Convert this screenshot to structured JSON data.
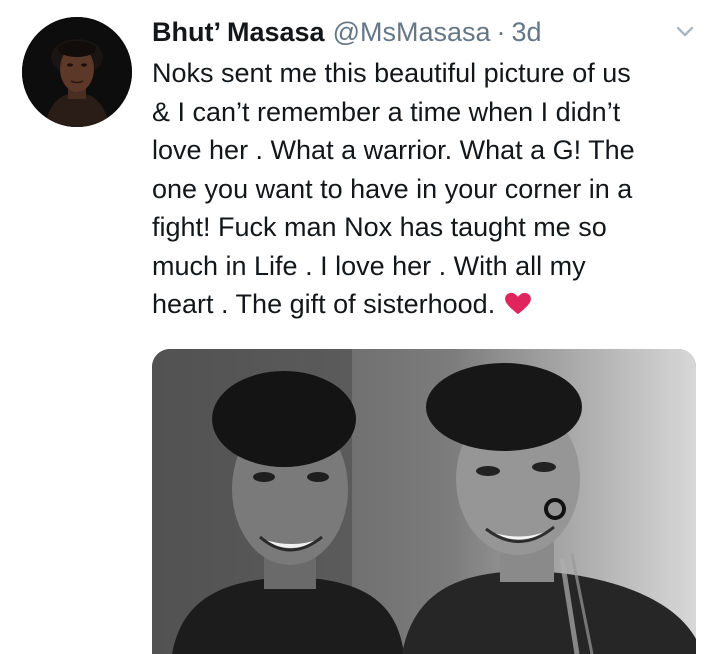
{
  "tweet": {
    "display_name": "Bhut’ Masasa",
    "handle": "@MsMasasa",
    "separator": "·",
    "time": "3d",
    "text_lines": [
      "Noks sent me this beautiful picture of us",
      "& I can’t remember a time when I didn’t",
      "love her . What a warrior. What a G! The",
      "one you want to have in your corner in a",
      "fight! Fuck man Nox has taught me so",
      "much in Life . I love her . With all my",
      "heart . The gift of sisterhood."
    ],
    "emoji": "heart-icon",
    "heart_color": "#e0245e"
  },
  "colors": {
    "text": "#14171a",
    "secondary": "#657786",
    "caret": "#aab8c2"
  }
}
